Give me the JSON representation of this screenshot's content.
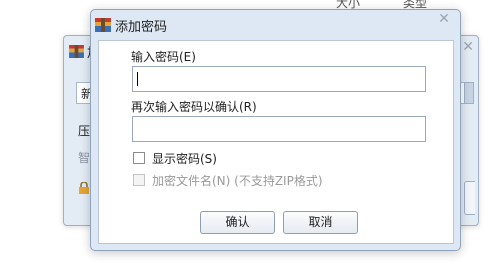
{
  "background": {
    "columns": [
      "大小",
      "类型"
    ],
    "dialog": {
      "title": "加",
      "field_value": "新",
      "label_1": "压",
      "label_2": "智"
    }
  },
  "dialog": {
    "title": "添加密码",
    "close_icon": "close-icon",
    "password": {
      "label": "输入密码(E)",
      "value": ""
    },
    "confirm": {
      "label": "再次输入密码以确认(R)",
      "value": ""
    },
    "show_password": {
      "label": "显示密码(S)",
      "checked": false
    },
    "encrypt_names": {
      "label": "加密文件名(N) (不支持ZIP格式)",
      "checked": false,
      "enabled": false
    },
    "ok_label": "确认",
    "cancel_label": "取消"
  }
}
